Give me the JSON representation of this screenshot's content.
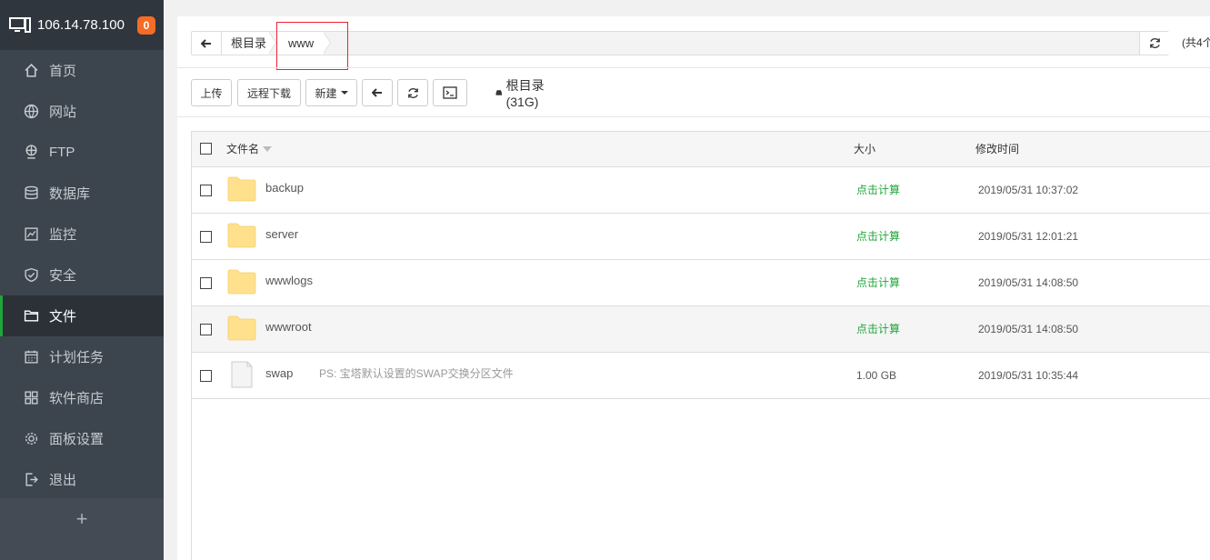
{
  "header": {
    "ip": "106.14.78.100",
    "badge": "0"
  },
  "sidebar": {
    "items": [
      {
        "label": "首页",
        "icon": "home-icon"
      },
      {
        "label": "网站",
        "icon": "globe-icon"
      },
      {
        "label": "FTP",
        "icon": "ftp-icon"
      },
      {
        "label": "数据库",
        "icon": "database-icon"
      },
      {
        "label": "监控",
        "icon": "monitor-chart-icon"
      },
      {
        "label": "安全",
        "icon": "shield-icon"
      },
      {
        "label": "文件",
        "icon": "folder-icon",
        "active": true
      },
      {
        "label": "计划任务",
        "icon": "calendar-icon"
      },
      {
        "label": "软件商店",
        "icon": "grid-icon"
      },
      {
        "label": "面板设置",
        "icon": "gear-icon"
      },
      {
        "label": "退出",
        "icon": "logout-icon"
      }
    ],
    "add_label": "+"
  },
  "breadcrumb": {
    "root": "根目录",
    "current": "www",
    "total": "(共4个"
  },
  "toolbar": {
    "upload": "上传",
    "remote_download": "远程下载",
    "new": "新建",
    "disk": "根目录(31G)"
  },
  "table": {
    "headers": {
      "name": "文件名",
      "size": "大小",
      "mtime": "修改时间"
    },
    "rows": [
      {
        "name": "backup",
        "desc": "",
        "size": "点击计算",
        "time": "2019/05/31 10:37:02",
        "type": "folder"
      },
      {
        "name": "server",
        "desc": "",
        "size": "点击计算",
        "time": "2019/05/31 12:01:21",
        "type": "folder"
      },
      {
        "name": "wwwlogs",
        "desc": "",
        "size": "点击计算",
        "time": "2019/05/31 14:08:50",
        "type": "folder"
      },
      {
        "name": "wwwroot",
        "desc": "",
        "size": "点击计算",
        "time": "2019/05/31 14:08:50",
        "type": "folder"
      },
      {
        "name": "swap",
        "desc": "PS: 宝塔默认设置的SWAP交换分区文件",
        "size": "1.00 GB",
        "time": "2019/05/31 10:35:44",
        "type": "file"
      }
    ]
  },
  "colors": {
    "sidebar": "#3c444d",
    "accent": "#20a53a",
    "badge": "#f56c27",
    "folder": "#ffe08c"
  }
}
